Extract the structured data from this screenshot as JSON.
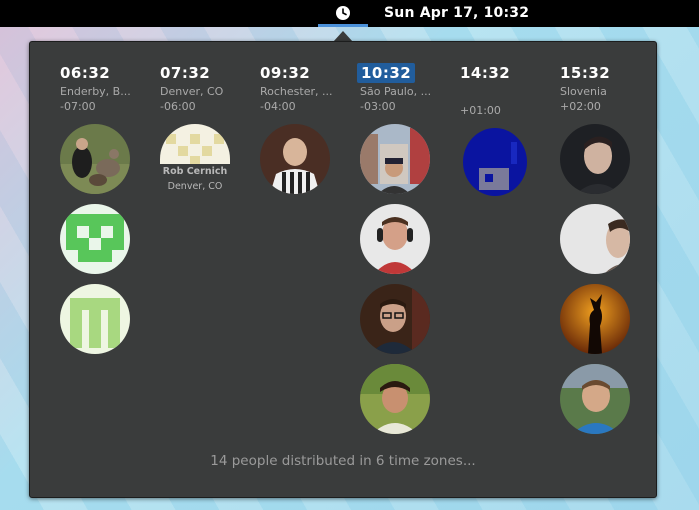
{
  "topbar": {
    "clock_icon": "clock-icon",
    "datetime": "Sun Apr 17, 10:32"
  },
  "colors": {
    "accent": "#215d9c",
    "popover_bg": "#3a3c3c"
  },
  "zones": [
    {
      "time": "06:32",
      "city": "Enderby, B...",
      "offset": "-07:00",
      "current": false,
      "people": [
        "person-with-dogs",
        "green-pattern-avatar",
        "green-m-avatar"
      ]
    },
    {
      "time": "07:32",
      "city": "Denver, CO",
      "offset": "-06:00",
      "current": false,
      "people": [
        "yellow-pattern-avatar"
      ],
      "person_name": "Rob Cernich",
      "person_city": "Denver, CO"
    },
    {
      "time": "09:32",
      "city": "Rochester, ...",
      "offset": "-04:00",
      "current": false,
      "people": [
        "bald-man-photo"
      ]
    },
    {
      "time": "10:32",
      "city": "São Paulo, ...",
      "offset": "-03:00",
      "current": true,
      "people": [
        "man-in-city-photo",
        "man-with-headphones-photo",
        "man-with-glasses-photo",
        "man-outdoors-photo"
      ]
    },
    {
      "time": "14:32",
      "city": "",
      "offset": "+01:00",
      "current": false,
      "people": [
        "blue-pixel-avatar"
      ]
    },
    {
      "time": "15:32",
      "city": "Slovenia",
      "offset": "+02:00",
      "current": false,
      "people": [
        "man-portrait-photo",
        "man-profile-photo",
        "silhouette-photo",
        "smiling-man-photo"
      ]
    }
  ],
  "footer": "14 people distributed in 6 time zones..."
}
